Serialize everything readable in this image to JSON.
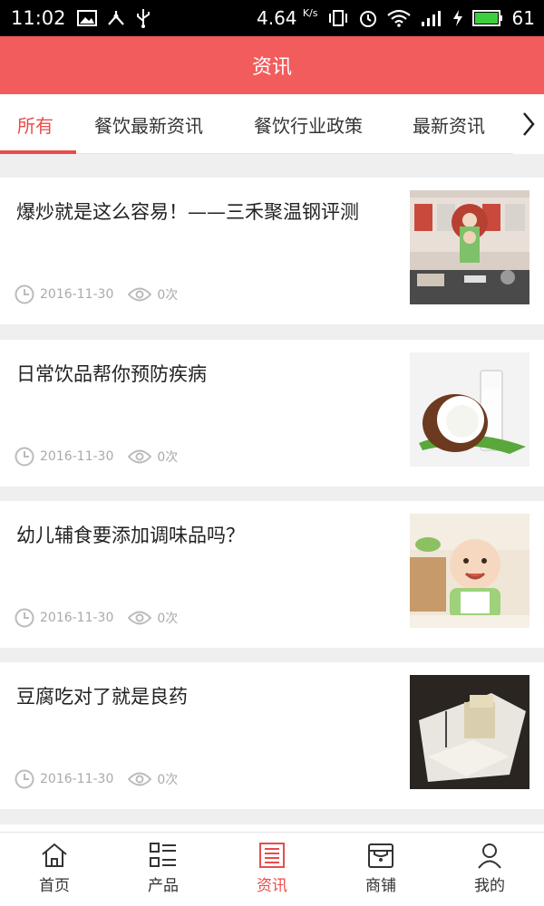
{
  "status_bar": {
    "time": "11:02",
    "speed": "4.64",
    "speed_unit": "K/s",
    "battery": "61"
  },
  "header": {
    "title": "资讯"
  },
  "tabs": [
    {
      "label": "所有",
      "active": true
    },
    {
      "label": "餐饮最新资讯",
      "active": false
    },
    {
      "label": "餐饮行业政策",
      "active": false
    },
    {
      "label": "最新资讯",
      "active": false
    }
  ],
  "articles": [
    {
      "title": "爆炒就是这么容易！——三禾聚温钢评测",
      "date": "2016-11-30",
      "views": "0次",
      "thumb": "chef-kitchen"
    },
    {
      "title": "日常饮品帮你预防疾病",
      "date": "2016-11-30",
      "views": "0次",
      "thumb": "coconut-milk"
    },
    {
      "title": "幼儿辅食要添加调味品吗？",
      "date": "2016-11-30",
      "views": "0次",
      "thumb": "baby"
    },
    {
      "title": "豆腐吃对了就是良药",
      "date": "2016-11-30",
      "views": "0次",
      "thumb": "tofu"
    }
  ],
  "bottom_nav": [
    {
      "label": "首页",
      "icon": "home-icon",
      "active": false
    },
    {
      "label": "产品",
      "icon": "list-icon",
      "active": false
    },
    {
      "label": "资讯",
      "icon": "news-icon",
      "active": true
    },
    {
      "label": "商铺",
      "icon": "store-icon",
      "active": false
    },
    {
      "label": "我的",
      "icon": "user-icon",
      "active": false
    }
  ],
  "colors": {
    "accent": "#f25c5c",
    "active_text": "#e94c4c",
    "meta_gray": "#aaaaaa"
  }
}
